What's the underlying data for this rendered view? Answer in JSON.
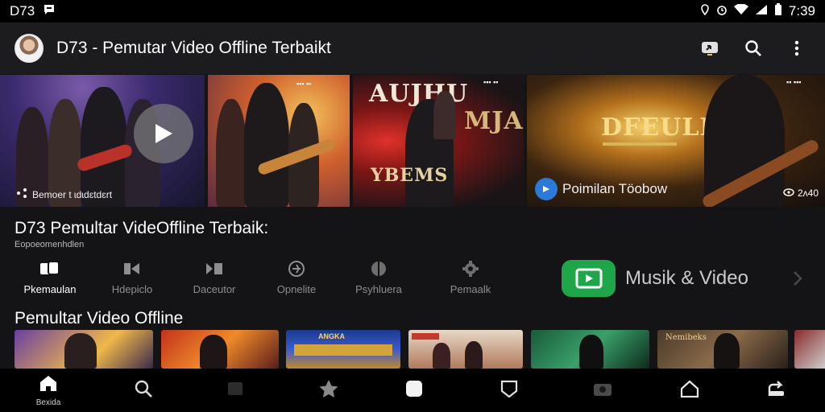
{
  "status_bar": {
    "carrier": "D73",
    "time": "7:39"
  },
  "app_bar": {
    "title": "D73 - Pemutar Video Offline Terbaikt"
  },
  "hero": {
    "tile1_caption": "Bemoer t ɩdɩdɛtdɛrt",
    "tile2_small": "▪▪▪ ▪▪",
    "tile3_top": "AUJHU",
    "tile3_mid": "MJAN",
    "tile3_bottom": "YBEMS",
    "tile4_title": "DFEULIAA",
    "tile4_caption": "Poimilan Töobow",
    "tile4_badge": "2ʌ40"
  },
  "section1": {
    "title": "D73 Pemultar VideOffline Terbaik:",
    "subtitle": "Eopoeomenhdlen"
  },
  "categories": [
    {
      "label": "Pkemaulan",
      "icon": "gallery-icon",
      "active": true
    },
    {
      "label": "Hdepiclo",
      "icon": "clip-icon",
      "active": false
    },
    {
      "label": "Daceutor",
      "icon": "media-icon",
      "active": false
    },
    {
      "label": "Opnelite",
      "icon": "compass-icon",
      "active": false
    },
    {
      "label": "Psyhluera",
      "icon": "split-icon",
      "active": false
    },
    {
      "label": "Pemaalk",
      "icon": "gear-icon",
      "active": false
    }
  ],
  "musik": {
    "label": "Musik & Video"
  },
  "section2": {
    "title": "Pemultar Video Offline"
  },
  "thumb_labels": [
    "",
    "",
    "ANGKA",
    "",
    "",
    "Nemibeks",
    ""
  ],
  "bottom_nav": [
    {
      "label": "Bexida",
      "icon": "home-icon"
    },
    {
      "label": "",
      "icon": "search-icon"
    },
    {
      "label": "",
      "icon": "grid-icon"
    },
    {
      "label": "",
      "icon": "star-icon"
    },
    {
      "label": "",
      "icon": "square-icon"
    },
    {
      "label": "",
      "icon": "shield-icon"
    },
    {
      "label": "",
      "icon": "camera-icon"
    },
    {
      "label": "",
      "icon": "house-outline-icon"
    },
    {
      "label": "",
      "icon": "share-icon"
    }
  ],
  "colors": {
    "background": "#141416",
    "appbar": "#1c1c1f",
    "accent_green": "#1fa64a"
  }
}
